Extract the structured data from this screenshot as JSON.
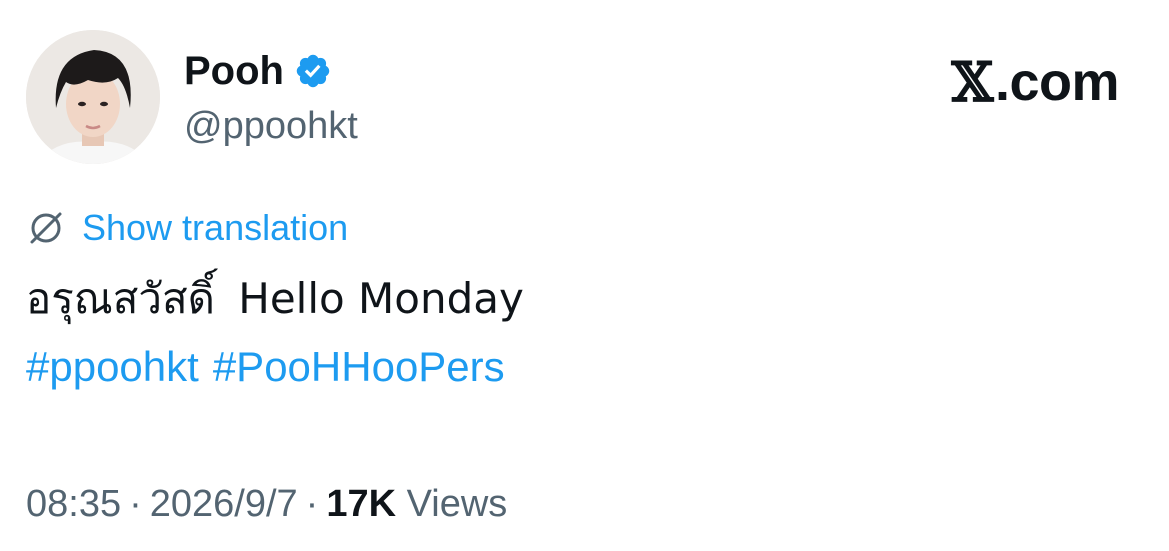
{
  "author": {
    "display_name": "Pooh",
    "handle": "@ppoohkt",
    "verified": true
  },
  "brand": {
    "glyph": "𝕏",
    "label": ".com"
  },
  "translation": {
    "label": "Show translation"
  },
  "tweet": {
    "text_thai": "อรุณสวัสดิ์",
    "text_en": "Hello Monday",
    "hashtags": [
      "#ppoohkt",
      "#PooHHooPers"
    ]
  },
  "meta": {
    "time": "08:35",
    "separator": "·",
    "date": "2026/9/7",
    "views_count": "17K",
    "views_label": "Views"
  },
  "colors": {
    "accent": "#1d9bf0",
    "text": "#0f1419",
    "muted": "#536471"
  },
  "icons": {
    "verified": "verified-badge-icon",
    "translate": "globe-strike-icon"
  }
}
